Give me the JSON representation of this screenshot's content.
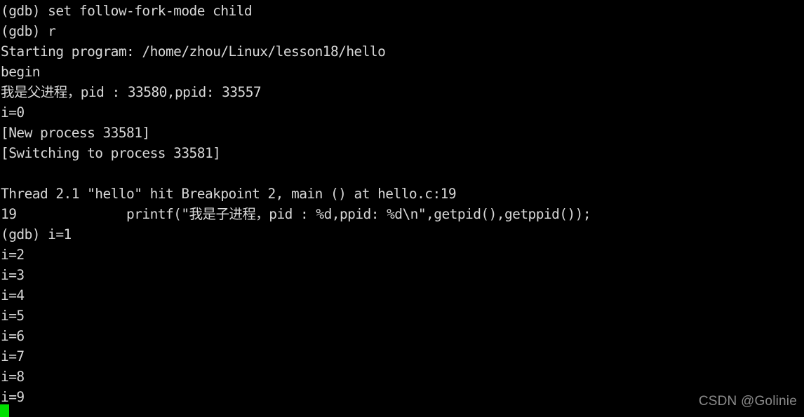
{
  "terminal": {
    "app": "gdb-session-terminal",
    "background_color": "#000000",
    "foreground_color": "#d8d8d8",
    "cursor_color": "#00e000",
    "columns": 80,
    "lines": [
      "(gdb) set follow-fork-mode child",
      "(gdb) r",
      "Starting program: /home/zhou/Linux/lesson18/hello",
      "begin",
      "我是父进程，pid : 33580,ppid: 33557",
      "i=0",
      "[New process 33581]",
      "[Switching to process 33581]",
      "",
      "Thread 2.1 \"hello\" hit Breakpoint 2, main () at hello.c:19",
      "19              printf(\"我是子进程，pid : %d,ppid: %d\\n\",getpid(),getppid());",
      "(gdb) i=1",
      "i=2",
      "i=3",
      "i=4",
      "i=5",
      "i=6",
      "i=7",
      "i=8",
      "i=9"
    ]
  },
  "cursor": {
    "name": "block-cursor",
    "color": "#00e000",
    "column": 0,
    "row": 20
  },
  "watermark": {
    "text": "CSDN @Golinie",
    "color": "#8a8a8a"
  }
}
